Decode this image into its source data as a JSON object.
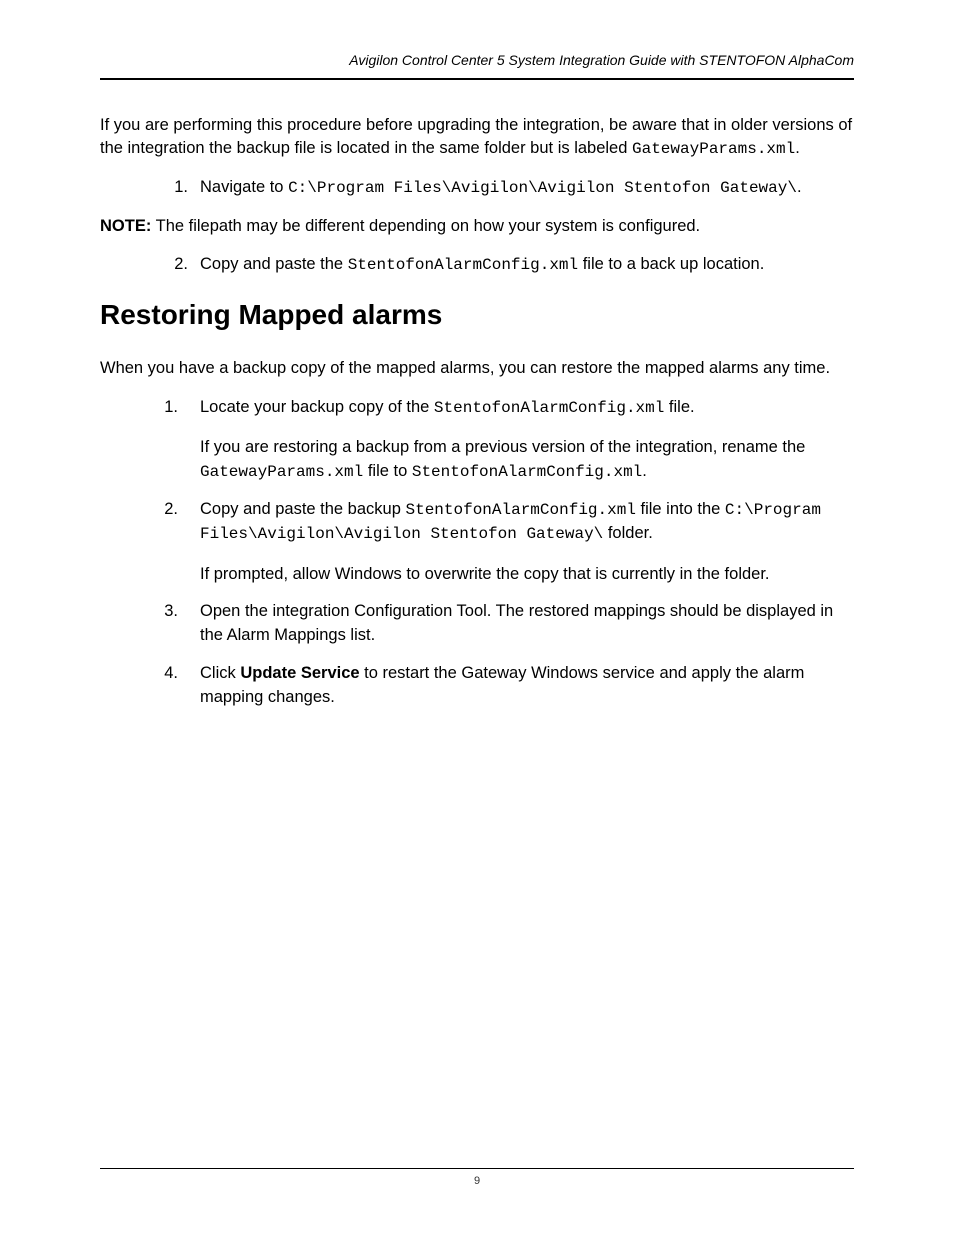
{
  "header": {
    "title": "Avigilon Control Center 5 System Integration Guide with STENTOFON AlphaCom"
  },
  "intro": {
    "text_before": "If you are performing this procedure before upgrading the integration, be aware that in older versions of the integration the backup file is located in the same folder but is labeled ",
    "code": "GatewayParams.xml",
    "text_after": "."
  },
  "list1": {
    "item1": {
      "num": "1.",
      "text_before": "Navigate to ",
      "code": "C:\\Program Files\\Avigilon\\Avigilon Stentofon Gateway\\",
      "text_after": "."
    },
    "item2": {
      "num": "2.",
      "text_before": "Copy and paste the ",
      "code": "StentofonAlarmConfig.xml",
      "text_after": " file to a back up location."
    }
  },
  "note": {
    "label": "NOTE:",
    "text": " The filepath may be different depending on how your system is configured."
  },
  "heading": "Restoring Mapped alarms",
  "section2_intro": "When you have a backup copy of the mapped alarms, you can restore the mapped alarms any time.",
  "list2": {
    "item1": {
      "num": "1.",
      "text_before": "Locate your backup copy of the ",
      "code": "StentofonAlarmConfig.xml",
      "text_after": " file.",
      "sub_text_before": "If you are restoring a backup from a previous version of the integration, rename the ",
      "sub_code1": "GatewayParams.xml",
      "sub_text_mid": " file to ",
      "sub_code2": "StentofonAlarmConfig.xml",
      "sub_text_after": "."
    },
    "item2": {
      "num": "2.",
      "text_before": "Copy and paste the backup ",
      "code1": "StentofonAlarmConfig.xml",
      "text_mid": " file into the ",
      "code2": "C:\\Program Files\\Avigilon\\Avigilon Stentofon Gateway\\",
      "text_after": " folder.",
      "sub_text": "If prompted, allow Windows to overwrite the copy that is currently in the folder."
    },
    "item3": {
      "num": "3.",
      "text": "Open the integration Configuration Tool. The restored mappings should be displayed in the Alarm Mappings list."
    },
    "item4": {
      "num": "4.",
      "text_before": "Click ",
      "bold": "Update Service",
      "text_after": " to restart the Gateway Windows service and apply the alarm mapping changes."
    }
  },
  "footer": {
    "page_number": "9"
  }
}
